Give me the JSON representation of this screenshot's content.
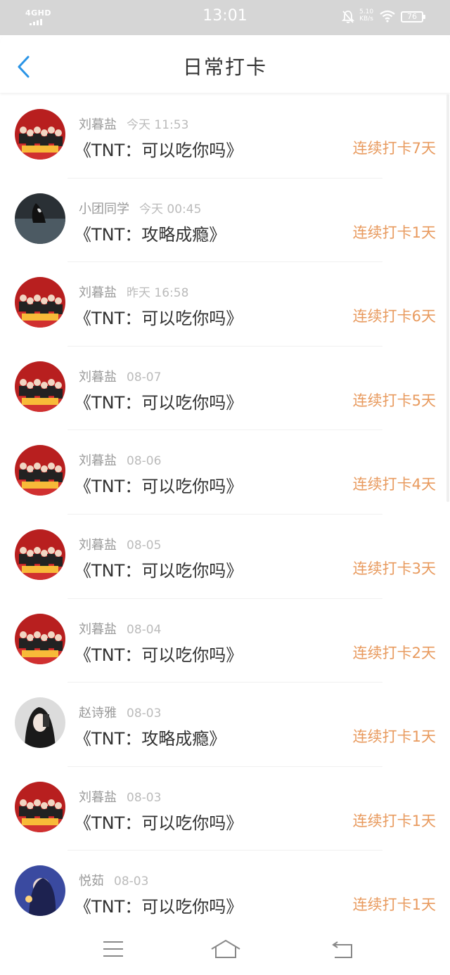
{
  "status_bar": {
    "network": "4GHD",
    "time": "13:01",
    "speed_value": "5.10",
    "speed_unit": "KB/s",
    "battery": "76"
  },
  "header": {
    "title": "日常打卡"
  },
  "avatar_colors": {
    "group": "#b81f1f",
    "dark": "#2a3035",
    "portrait": "#dcdcdc",
    "anime": "#3a4aa0"
  },
  "accent_color": "#e89a5e",
  "entries": [
    {
      "name": "刘暮盐",
      "time": "今天 11:53",
      "book": "《TNT：可以吃你吗》",
      "streak": "连续打卡7天",
      "avatar": "group-photo-icon"
    },
    {
      "name": "小团同学",
      "time": "今天 00:45",
      "book": "《TNT：攻略成瘾》",
      "streak": "连续打卡1天",
      "avatar": "dark-photo-icon"
    },
    {
      "name": "刘暮盐",
      "time": "昨天 16:58",
      "book": "《TNT：可以吃你吗》",
      "streak": "连续打卡6天",
      "avatar": "group-photo-icon"
    },
    {
      "name": "刘暮盐",
      "time": "08-07",
      "book": "《TNT：可以吃你吗》",
      "streak": "连续打卡5天",
      "avatar": "group-photo-icon"
    },
    {
      "name": "刘暮盐",
      "time": "08-06",
      "book": "《TNT：可以吃你吗》",
      "streak": "连续打卡4天",
      "avatar": "group-photo-icon"
    },
    {
      "name": "刘暮盐",
      "time": "08-05",
      "book": "《TNT：可以吃你吗》",
      "streak": "连续打卡3天",
      "avatar": "group-photo-icon"
    },
    {
      "name": "刘暮盐",
      "time": "08-04",
      "book": "《TNT：可以吃你吗》",
      "streak": "连续打卡2天",
      "avatar": "group-photo-icon"
    },
    {
      "name": "赵诗雅",
      "time": "08-03",
      "book": "《TNT：攻略成瘾》",
      "streak": "连续打卡1天",
      "avatar": "portrait-photo-icon"
    },
    {
      "name": "刘暮盐",
      "time": "08-03",
      "book": "《TNT：可以吃你吗》",
      "streak": "连续打卡1天",
      "avatar": "group-photo-icon"
    },
    {
      "name": "悦茹",
      "time": "08-03",
      "book": "《TNT：可以吃你吗》",
      "streak": "连续打卡1天",
      "avatar": "anime-photo-icon"
    }
  ],
  "nav_bar": {
    "menu_icon": "menu-icon",
    "home_icon": "home-icon",
    "back_icon": "return-icon"
  }
}
